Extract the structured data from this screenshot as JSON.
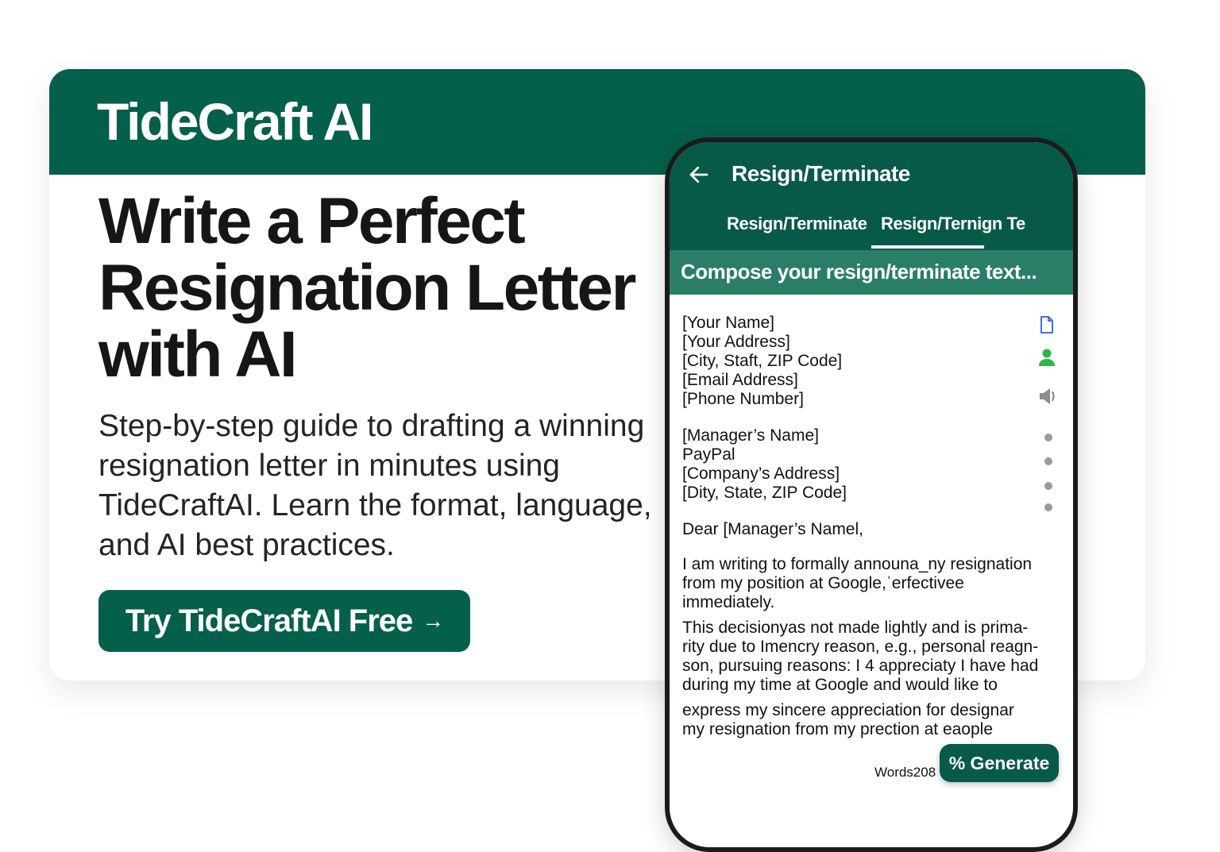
{
  "brand": "TideCraft AI",
  "hero": {
    "title_lines": [
      "Write a Perfect",
      "Resignation Letter",
      "with AI"
    ],
    "subtitle": "Step-by-step guide to drafting a winning resignation letter in minutes using TideCraftAI. Learn the format, language, and AI best practices.",
    "cta_label": "Try TideCraftAI Free",
    "cta_arrow": "→"
  },
  "phone": {
    "app_title": "Resign/Terminate",
    "tabs": [
      "Resign/Terminate",
      "Resign/Ternign Te"
    ],
    "active_tab": 1,
    "compose_placeholder": "Compose your resign/terminate text...",
    "letter": {
      "sender": [
        "[Your Name]",
        "[Your Address]",
        "[City, Staft, ZIP Code]",
        "[Email Address]",
        "[Phone Number]"
      ],
      "recipient": [
        "[Manager’s Name]",
        "PayPal",
        "[Company’s Address]",
        "[Dity, State, ZIP Code]"
      ],
      "greeting": "Dear [Manager’s Namel,",
      "para1": [
        "I am writing to formally announa_ny resignation",
        "from my position at Google,ˈerfectivee",
        "immediately."
      ],
      "para2": [
        "This decisionyas not made lightly and is prima-",
        "rity due to Imencry reason, e.g., personal reagn-",
        "son, pursuing reasons: I 4 appreciaty I have had",
        "during my time at Google and would like to"
      ],
      "para3": [
        "express my sincere appreciation for designar",
        "my resignation from my prection at eaople"
      ]
    },
    "word_count": "Words208",
    "generate_label": "% Generate"
  }
}
